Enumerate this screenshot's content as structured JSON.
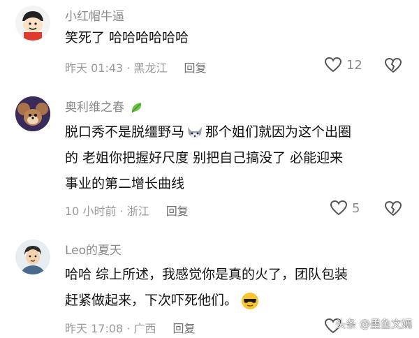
{
  "comments": [
    {
      "username": "小红帽牛逼",
      "lines": [
        "笑死了 哈哈哈哈哈哈"
      ],
      "time": "昨天 01:43 · 黑龙江",
      "reply": "回复",
      "likes": "12"
    },
    {
      "username": "奥利维之春",
      "lines": [
        "脱口秀不是脱缰野马",
        "那个姐们就因为这个出圈",
        "的 老姐你把握好尺度 别把自己搞没了 必能迎来",
        "事业的第二增长曲线"
      ],
      "time": "10 小时前 · 浙江",
      "reply": "回复",
      "likes": "5"
    },
    {
      "username": "Leo的夏天",
      "lines": [
        "哈哈 综上所述，我感觉你是真的火了，团队包装",
        "赶紧做起来，下次吓死他们。"
      ],
      "time": "昨天 17:08 · 广西",
      "reply": "回复",
      "likes": ""
    }
  ],
  "watermark": "头条 @墨鱼文嫣",
  "icons": {
    "like": "heart-outline-icon",
    "dislike": "broken-heart-icon",
    "badge": "leaf-badge-icon"
  }
}
